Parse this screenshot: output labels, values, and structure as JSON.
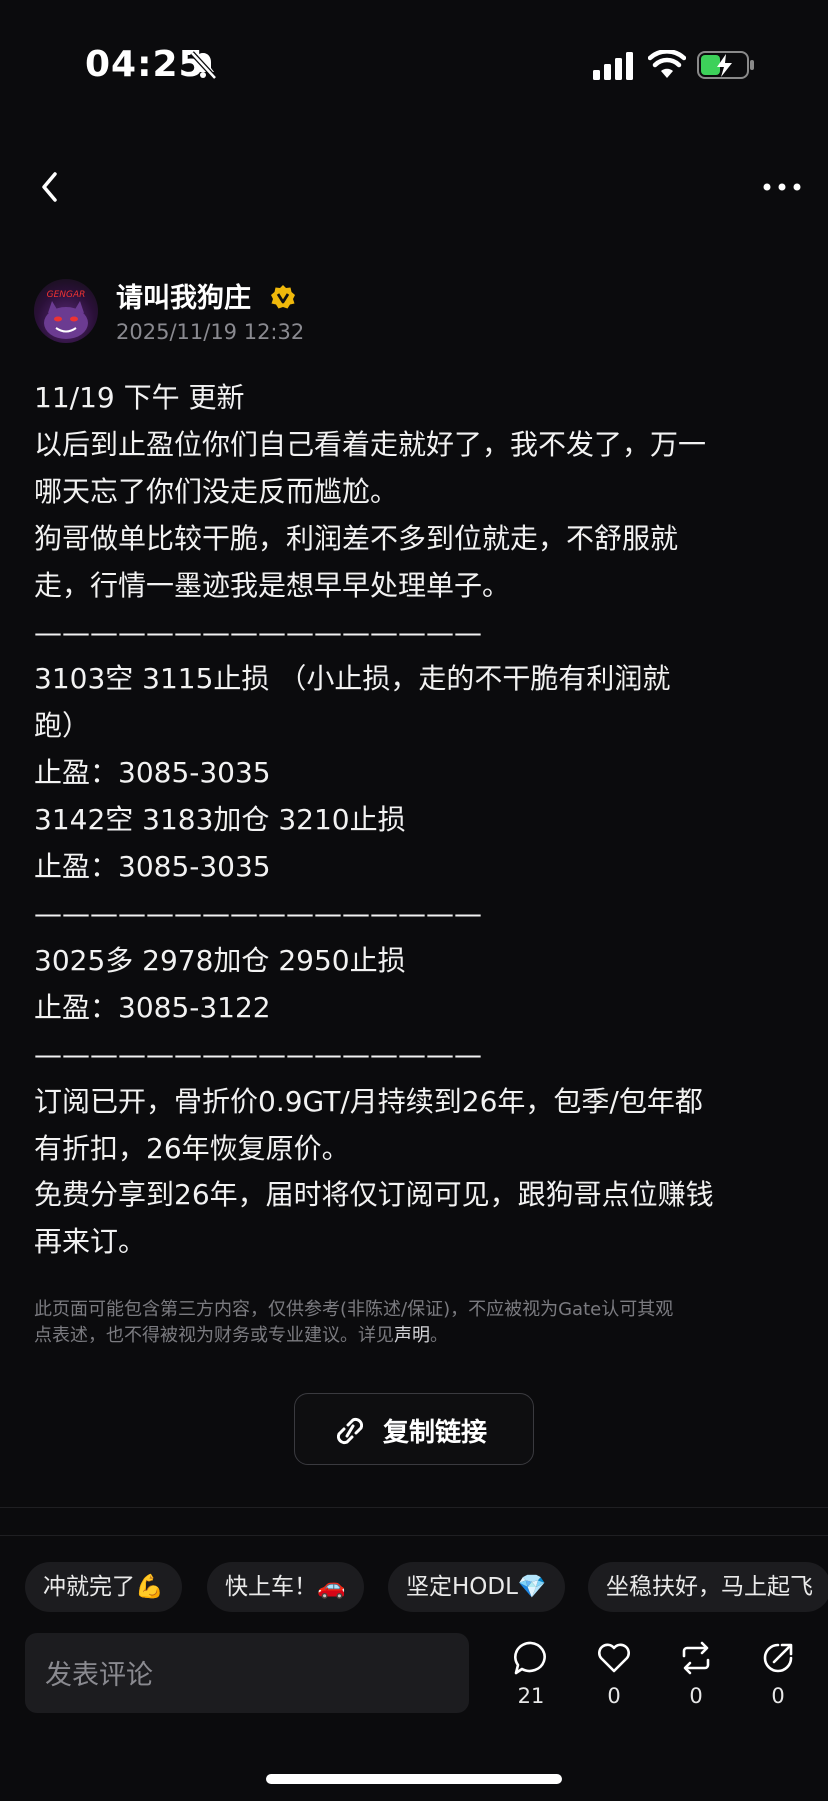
{
  "status_bar": {
    "time": "04:25"
  },
  "post": {
    "author": "请叫我狗庄",
    "timestamp": "2025/11/19 12:32",
    "lines": [
      "11/19  下午  更新",
      "以后到止盈位你们自己看着走就好了，我不发了，万一",
      "哪天忘了你们没走反而尴尬。",
      "狗哥做单比较干脆，利润差不多到位就走，不舒服就",
      "走，行情一墨迹我是想早早处理单子。",
      "————————————————",
      "3103空  3115止损 （小止损，走的不干脆有利润就",
      "跑）",
      "止盈：3085-3035",
      "3142空 3183加仓 3210止损",
      "止盈：3085-3035",
      "————————————————",
      "3025多 2978加仓 2950止损",
      "止盈：3085-3122",
      "————————————————",
      "订阅已开，骨折价0.9GT/月持续到26年，包季/包年都",
      "有折扣，26年恢复原价。",
      "免费分享到26年，届时将仅订阅可见，跟狗哥点位赚钱",
      "再来订。"
    ]
  },
  "disclaimer": {
    "line1": "此页面可能包含第三方内容，仅供参考(非陈述/保证)，不应被视为Gate认可其观",
    "line2": "点表述，也不得被视为财务或专业建议。详见",
    "link": "声明",
    "end": "。"
  },
  "copy_link": {
    "label": "复制链接"
  },
  "quick_replies": [
    "冲就完了💪",
    "快上车！🚗",
    "坚定HODL💎",
    "坐稳扶好，马上起飞"
  ],
  "comment": {
    "placeholder": "发表评论"
  },
  "actions": {
    "comments": "21",
    "likes": "0",
    "reposts": "0",
    "shares": "0"
  },
  "colors": {
    "background": "#0b0b0d",
    "verified_badge": "#f0b90b",
    "battery_green": "#3dd15a"
  }
}
